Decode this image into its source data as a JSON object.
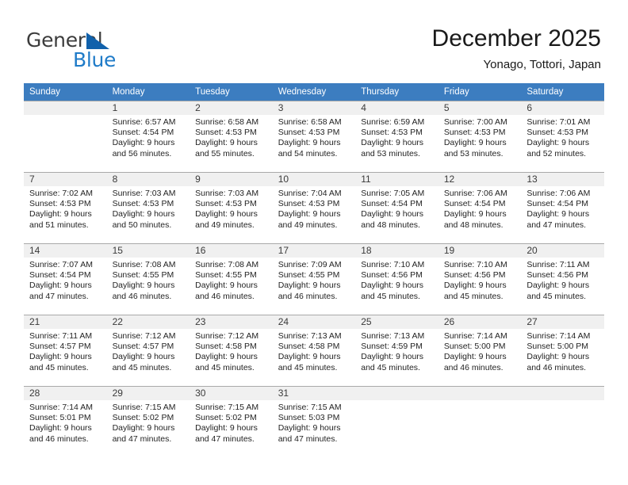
{
  "logo": {
    "word1": "General",
    "word2": "Blue",
    "triangle_color": "#1161ab",
    "blue_color": "#1f7bc8"
  },
  "header": {
    "title": "December 2025",
    "subtitle": "Yonago, Tottori, Japan"
  },
  "theme": {
    "header_blue": "#3c7dc0",
    "daynum_bg": "#f0f0f0",
    "grid_line": "#a9a9a9"
  },
  "weekday_headers": [
    "Sunday",
    "Monday",
    "Tuesday",
    "Wednesday",
    "Thursday",
    "Friday",
    "Saturday"
  ],
  "weeks": [
    [
      {
        "day": "",
        "sunrise": "",
        "sunset": "",
        "daylight1": "",
        "daylight2": ""
      },
      {
        "day": "1",
        "sunrise": "Sunrise: 6:57 AM",
        "sunset": "Sunset: 4:54 PM",
        "daylight1": "Daylight: 9 hours",
        "daylight2": "and 56 minutes."
      },
      {
        "day": "2",
        "sunrise": "Sunrise: 6:58 AM",
        "sunset": "Sunset: 4:53 PM",
        "daylight1": "Daylight: 9 hours",
        "daylight2": "and 55 minutes."
      },
      {
        "day": "3",
        "sunrise": "Sunrise: 6:58 AM",
        "sunset": "Sunset: 4:53 PM",
        "daylight1": "Daylight: 9 hours",
        "daylight2": "and 54 minutes."
      },
      {
        "day": "4",
        "sunrise": "Sunrise: 6:59 AM",
        "sunset": "Sunset: 4:53 PM",
        "daylight1": "Daylight: 9 hours",
        "daylight2": "and 53 minutes."
      },
      {
        "day": "5",
        "sunrise": "Sunrise: 7:00 AM",
        "sunset": "Sunset: 4:53 PM",
        "daylight1": "Daylight: 9 hours",
        "daylight2": "and 53 minutes."
      },
      {
        "day": "6",
        "sunrise": "Sunrise: 7:01 AM",
        "sunset": "Sunset: 4:53 PM",
        "daylight1": "Daylight: 9 hours",
        "daylight2": "and 52 minutes."
      }
    ],
    [
      {
        "day": "7",
        "sunrise": "Sunrise: 7:02 AM",
        "sunset": "Sunset: 4:53 PM",
        "daylight1": "Daylight: 9 hours",
        "daylight2": "and 51 minutes."
      },
      {
        "day": "8",
        "sunrise": "Sunrise: 7:03 AM",
        "sunset": "Sunset: 4:53 PM",
        "daylight1": "Daylight: 9 hours",
        "daylight2": "and 50 minutes."
      },
      {
        "day": "9",
        "sunrise": "Sunrise: 7:03 AM",
        "sunset": "Sunset: 4:53 PM",
        "daylight1": "Daylight: 9 hours",
        "daylight2": "and 49 minutes."
      },
      {
        "day": "10",
        "sunrise": "Sunrise: 7:04 AM",
        "sunset": "Sunset: 4:53 PM",
        "daylight1": "Daylight: 9 hours",
        "daylight2": "and 49 minutes."
      },
      {
        "day": "11",
        "sunrise": "Sunrise: 7:05 AM",
        "sunset": "Sunset: 4:54 PM",
        "daylight1": "Daylight: 9 hours",
        "daylight2": "and 48 minutes."
      },
      {
        "day": "12",
        "sunrise": "Sunrise: 7:06 AM",
        "sunset": "Sunset: 4:54 PM",
        "daylight1": "Daylight: 9 hours",
        "daylight2": "and 48 minutes."
      },
      {
        "day": "13",
        "sunrise": "Sunrise: 7:06 AM",
        "sunset": "Sunset: 4:54 PM",
        "daylight1": "Daylight: 9 hours",
        "daylight2": "and 47 minutes."
      }
    ],
    [
      {
        "day": "14",
        "sunrise": "Sunrise: 7:07 AM",
        "sunset": "Sunset: 4:54 PM",
        "daylight1": "Daylight: 9 hours",
        "daylight2": "and 47 minutes."
      },
      {
        "day": "15",
        "sunrise": "Sunrise: 7:08 AM",
        "sunset": "Sunset: 4:55 PM",
        "daylight1": "Daylight: 9 hours",
        "daylight2": "and 46 minutes."
      },
      {
        "day": "16",
        "sunrise": "Sunrise: 7:08 AM",
        "sunset": "Sunset: 4:55 PM",
        "daylight1": "Daylight: 9 hours",
        "daylight2": "and 46 minutes."
      },
      {
        "day": "17",
        "sunrise": "Sunrise: 7:09 AM",
        "sunset": "Sunset: 4:55 PM",
        "daylight1": "Daylight: 9 hours",
        "daylight2": "and 46 minutes."
      },
      {
        "day": "18",
        "sunrise": "Sunrise: 7:10 AM",
        "sunset": "Sunset: 4:56 PM",
        "daylight1": "Daylight: 9 hours",
        "daylight2": "and 45 minutes."
      },
      {
        "day": "19",
        "sunrise": "Sunrise: 7:10 AM",
        "sunset": "Sunset: 4:56 PM",
        "daylight1": "Daylight: 9 hours",
        "daylight2": "and 45 minutes."
      },
      {
        "day": "20",
        "sunrise": "Sunrise: 7:11 AM",
        "sunset": "Sunset: 4:56 PM",
        "daylight1": "Daylight: 9 hours",
        "daylight2": "and 45 minutes."
      }
    ],
    [
      {
        "day": "21",
        "sunrise": "Sunrise: 7:11 AM",
        "sunset": "Sunset: 4:57 PM",
        "daylight1": "Daylight: 9 hours",
        "daylight2": "and 45 minutes."
      },
      {
        "day": "22",
        "sunrise": "Sunrise: 7:12 AM",
        "sunset": "Sunset: 4:57 PM",
        "daylight1": "Daylight: 9 hours",
        "daylight2": "and 45 minutes."
      },
      {
        "day": "23",
        "sunrise": "Sunrise: 7:12 AM",
        "sunset": "Sunset: 4:58 PM",
        "daylight1": "Daylight: 9 hours",
        "daylight2": "and 45 minutes."
      },
      {
        "day": "24",
        "sunrise": "Sunrise: 7:13 AM",
        "sunset": "Sunset: 4:58 PM",
        "daylight1": "Daylight: 9 hours",
        "daylight2": "and 45 minutes."
      },
      {
        "day": "25",
        "sunrise": "Sunrise: 7:13 AM",
        "sunset": "Sunset: 4:59 PM",
        "daylight1": "Daylight: 9 hours",
        "daylight2": "and 45 minutes."
      },
      {
        "day": "26",
        "sunrise": "Sunrise: 7:14 AM",
        "sunset": "Sunset: 5:00 PM",
        "daylight1": "Daylight: 9 hours",
        "daylight2": "and 46 minutes."
      },
      {
        "day": "27",
        "sunrise": "Sunrise: 7:14 AM",
        "sunset": "Sunset: 5:00 PM",
        "daylight1": "Daylight: 9 hours",
        "daylight2": "and 46 minutes."
      }
    ],
    [
      {
        "day": "28",
        "sunrise": "Sunrise: 7:14 AM",
        "sunset": "Sunset: 5:01 PM",
        "daylight1": "Daylight: 9 hours",
        "daylight2": "and 46 minutes."
      },
      {
        "day": "29",
        "sunrise": "Sunrise: 7:15 AM",
        "sunset": "Sunset: 5:02 PM",
        "daylight1": "Daylight: 9 hours",
        "daylight2": "and 47 minutes."
      },
      {
        "day": "30",
        "sunrise": "Sunrise: 7:15 AM",
        "sunset": "Sunset: 5:02 PM",
        "daylight1": "Daylight: 9 hours",
        "daylight2": "and 47 minutes."
      },
      {
        "day": "31",
        "sunrise": "Sunrise: 7:15 AM",
        "sunset": "Sunset: 5:03 PM",
        "daylight1": "Daylight: 9 hours",
        "daylight2": "and 47 minutes."
      },
      {
        "day": "",
        "sunrise": "",
        "sunset": "",
        "daylight1": "",
        "daylight2": ""
      },
      {
        "day": "",
        "sunrise": "",
        "sunset": "",
        "daylight1": "",
        "daylight2": ""
      },
      {
        "day": "",
        "sunrise": "",
        "sunset": "",
        "daylight1": "",
        "daylight2": ""
      }
    ]
  ]
}
